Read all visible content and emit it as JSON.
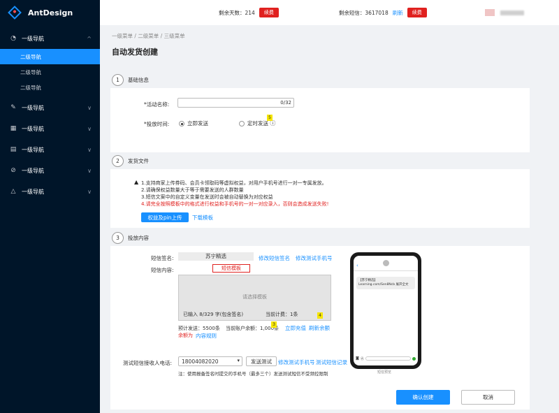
{
  "app": {
    "logo_text": "AntDesign"
  },
  "sidebar": {
    "groups": [
      {
        "label": "一级导航",
        "icon": "dashboard-icon",
        "expanded": true,
        "subitems": [
          "二级导航",
          "二级导航",
          "二级导航"
        ]
      },
      {
        "label": "一级导航",
        "icon": "edit-icon"
      },
      {
        "label": "一级导航",
        "icon": "table-icon"
      },
      {
        "label": "一级导航",
        "icon": "profile-icon"
      },
      {
        "label": "一级导航",
        "icon": "check-circle-icon"
      },
      {
        "label": "一级导航",
        "icon": "warning-icon"
      }
    ]
  },
  "topbar": {
    "remaining_days_label": "剩余天数：",
    "remaining_days_value": "214",
    "renew_label": "续费",
    "remaining_sms_label": "剩余短信：",
    "remaining_sms_value": "3617018",
    "refresh_label": "刷新",
    "renew2_label": "续费"
  },
  "breadcrumb": {
    "l1": "一级菜单",
    "l2": "二级菜单",
    "l3": "三级菜单",
    "sep": "/"
  },
  "page_title": "自动发货创建",
  "steps": [
    {
      "num": "1",
      "title": "基础信息"
    },
    {
      "num": "2",
      "title": "发货文件"
    },
    {
      "num": "3",
      "title": "投放内容"
    }
  ],
  "basic": {
    "activity_name_label": "*活动名称:",
    "activity_name_value": "",
    "activity_name_counter": "0/32",
    "delivery_time_label": "*投放时间:",
    "immediate_label": "立即发送",
    "scheduled_label": "定时发送",
    "badge_5": "5"
  },
  "file": {
    "notes": [
      "1.支持商家上传券码、会员卡领取码等虚拟权益，对用户手机号进行一对一专属发放。",
      "2.请确保权益数量大于等于需要发送的人群数量",
      "3.短信文案中的自定义变量在发送时会被自动替换为对应权益"
    ],
    "warning_note": "4.请完全按照模板中的格式进行权益和手机号的一对一对应录入，否则会造成发送失败!",
    "upload_button": "权益及pin上传",
    "download_link": "下载模板"
  },
  "content": {
    "sms_sign_label": "短信签名:",
    "sms_sign_value": "苏宁精选",
    "edit_sign_link": "修改短信签名",
    "edit_test_phone_link": "修改测试手机号",
    "sms_content_label": "短信内容:",
    "template_button": "短信模板",
    "template_placeholder": "请选择模板",
    "input_count_text": "已输入 8/329 字(包含签名)",
    "billing_text": "当前计费：1条",
    "badge_4": "4",
    "expected_send": "预计发送：5500条",
    "account_balance": "当前账户余额：1,000条",
    "badge_3": "3",
    "recharge_link": "立即充值",
    "refresh_balance_link": "刷新余额",
    "rule_text": "余额为",
    "rule_link": "内容规则",
    "test_phone_label": "测试短信接收人电话:",
    "test_phone_value": "18004082020",
    "send_test_button": "发送测试",
    "edit_test_numbers_link": "修改测试手机号",
    "test_record_link": "测试短信记录",
    "test_note": "注：使用报备签名时提交的手机号（最多三个）发送测试短信不受频控限制",
    "phone_preview_caption": "短信预览",
    "phone_message": "【苏宁精选】 Learning.com/Sen8Ncb 展开全文"
  },
  "actions": {
    "confirm": "确认创建",
    "cancel": "取消"
  },
  "colors": {
    "primary": "#1890ff",
    "danger": "#e0211f",
    "sidebar_bg": "#001529"
  }
}
